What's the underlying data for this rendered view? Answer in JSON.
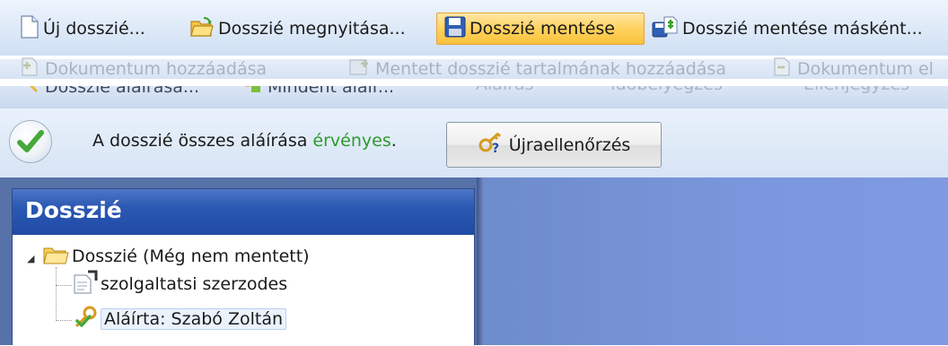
{
  "toolbar": {
    "new_label": "Új dosszié...",
    "open_label": "Dosszié megnyitása...",
    "save_label": "Dosszié mentése",
    "save_as_label": "Dosszié mentése másként...",
    "row2": {
      "add_document_label": "Dokumentum hozzáadása",
      "add_saved_label": "Mentett dosszié tartalmának hozzáadása",
      "document_cut_label": "Dokumentum el"
    },
    "row3": {
      "sign_dossier_label": "Dosszié aláírása...",
      "sign_all_label": "Mindent aláír...",
      "sign_label": "Aláírás",
      "timestamp_label": "Időbélyegzés",
      "countersign_label": "Ellenjegyzés"
    }
  },
  "status": {
    "prefix": "A dosszié összes aláírása ",
    "state": "érvényes",
    "suffix": ".",
    "recheck_label": "Újraellenőrzés",
    "state_color": "#2c9a2c"
  },
  "panel": {
    "title": "Dosszié",
    "tree": {
      "root": "Dosszié (Még nem mentett)",
      "children": [
        "szolgaltatsi szerzodes",
        "Aláírta: Szabó Zoltán"
      ]
    }
  },
  "icons": {
    "new": "document-icon",
    "open": "folder-open-icon",
    "save": "floppy-disk-icon",
    "save_as": "save-as-icon",
    "status": "check-icon",
    "recheck": "key-question-icon",
    "folder": "folder-icon",
    "document": "document-edit-icon",
    "signature": "key-check-icon"
  },
  "colors": {
    "accent": "#f9c23c",
    "header": "#2b58b2",
    "workspace": "#7b97dd"
  }
}
